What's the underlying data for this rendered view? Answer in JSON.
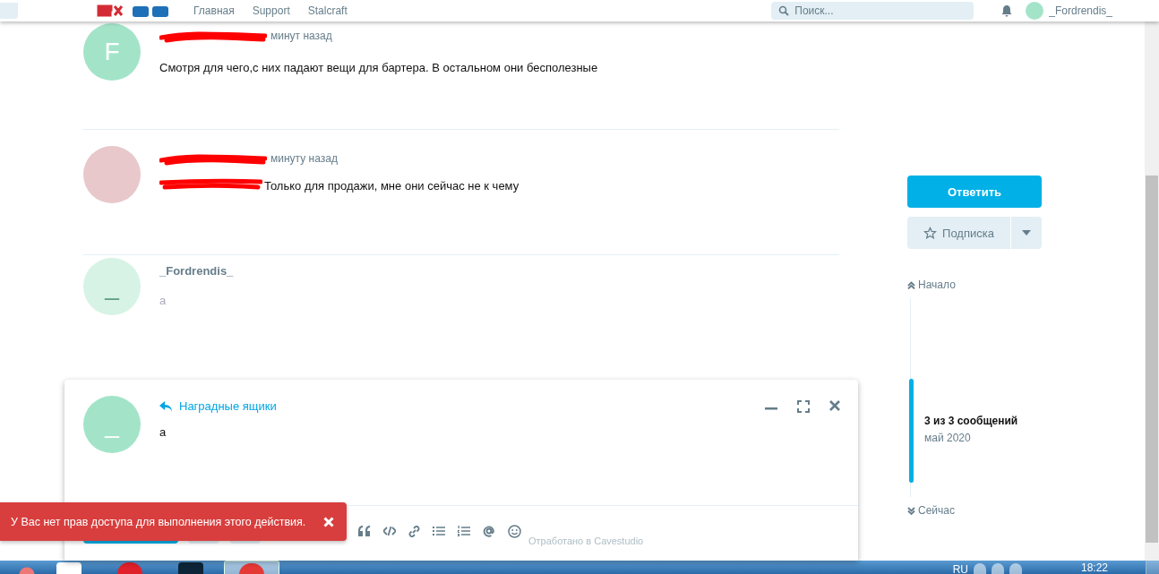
{
  "header": {
    "nav": [
      "Главная",
      "Support",
      "Stalcraft"
    ],
    "search": {
      "placeholder": "Поиск..."
    },
    "user": {
      "name": "_Fordrendis_"
    }
  },
  "posts": [
    {
      "kind": "letter",
      "avatar_letter": "F",
      "name_redacted": true,
      "time": "минут назад",
      "text_redacted": false,
      "text": "Смотря для чего,с них падают вещи для бартера. В остальном они бесполезные"
    },
    {
      "kind": "photo",
      "name_redacted": true,
      "time": "минуту назад",
      "text_redacted": true,
      "text": "Только для продажи, мне они сейчас не к чему"
    },
    {
      "kind": "preview",
      "avatar_letter": "_",
      "author": "_Fordrendis_",
      "text": "a"
    }
  ],
  "composer": {
    "avatar_letter": "_",
    "reply_to": "Наградные ящики",
    "text": "a",
    "footer_note": "Отработано в Cavestudio"
  },
  "sidebar": {
    "reply_button": "Ответить",
    "follow_button": "Подписка",
    "scrubber": {
      "start": "Начало",
      "position": "3 из 3 сообщений",
      "date": "май 2020",
      "end": "Сейчас"
    }
  },
  "toast": {
    "message": "У Вас нет прав доступа для выполнения этого действия."
  },
  "taskbar": {
    "language": "RU",
    "time": "18:22"
  }
}
